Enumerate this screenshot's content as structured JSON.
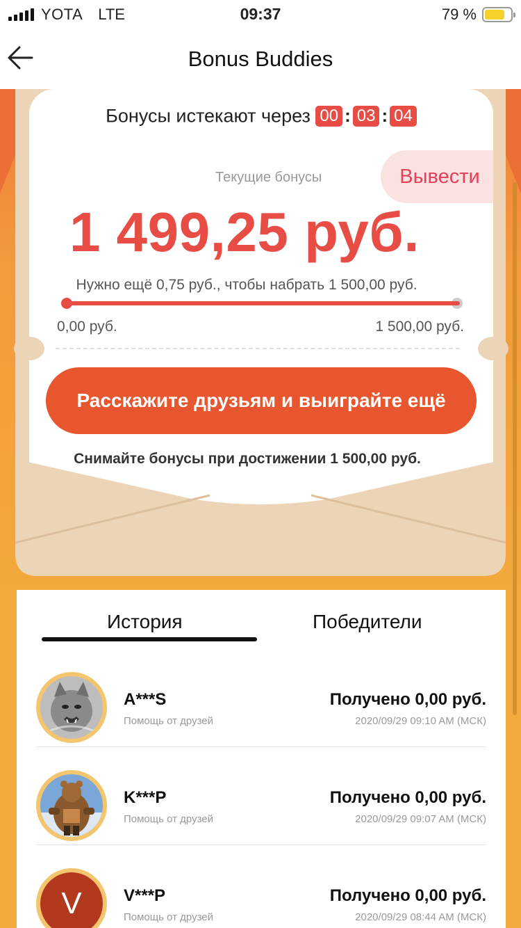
{
  "status": {
    "carrier": "YOTA",
    "network": "LTE",
    "time": "09:37",
    "battery": "79 %",
    "battery_level": 0.79,
    "battery_color": "#f7d02a"
  },
  "nav": {
    "title": "Bonus Buddies",
    "back_icon": "arrow-left-icon"
  },
  "bonus": {
    "expire_label": "Бонусы истекают через",
    "timer": [
      "00",
      "03",
      "04"
    ],
    "timer_sep": ":",
    "withdraw_label": "Вывести",
    "current_label": "Текущие бонусы",
    "amount": "1 499,25 руб.",
    "need_text": "Нужно ещё 0,75 руб., чтобы набрать 1 500,00 руб.",
    "progress": 0.9995,
    "min_label": "0,00 руб.",
    "max_label": "1 500,00 руб.",
    "share_button": "Расскажите друзьям и выиграйте ещё",
    "withdraw_note": "Снимайте бонусы при достижении 1 500,00 руб."
  },
  "tabs": {
    "history": "История",
    "winners": "Победители",
    "active": "history"
  },
  "history": [
    {
      "name": "A***S",
      "subtitle": "Помощь от друзей",
      "received": "Получено 0,00 руб.",
      "date": "2020/09/29 09:10 AM (МСК)",
      "avatar": "cat-photo"
    },
    {
      "name": "K***P",
      "subtitle": "Помощь от друзей",
      "received": "Получено 0,00 руб.",
      "date": "2020/09/29 09:07 AM (МСК)",
      "avatar": "bear-warrior-photo"
    },
    {
      "name": "V***P",
      "subtitle": "Помощь от друзей",
      "received": "Получено 0,00 руб.",
      "date": "2020/09/29 08:44 AM (МСК)",
      "avatar": "letter",
      "avatar_letter": "V"
    }
  ],
  "colors": {
    "accent_red": "#e74c45",
    "button_orange": "#e8562f",
    "background_orange": "#f3a93c",
    "envelope": "#ecd4b6",
    "withdraw_text": "#e4405a"
  }
}
